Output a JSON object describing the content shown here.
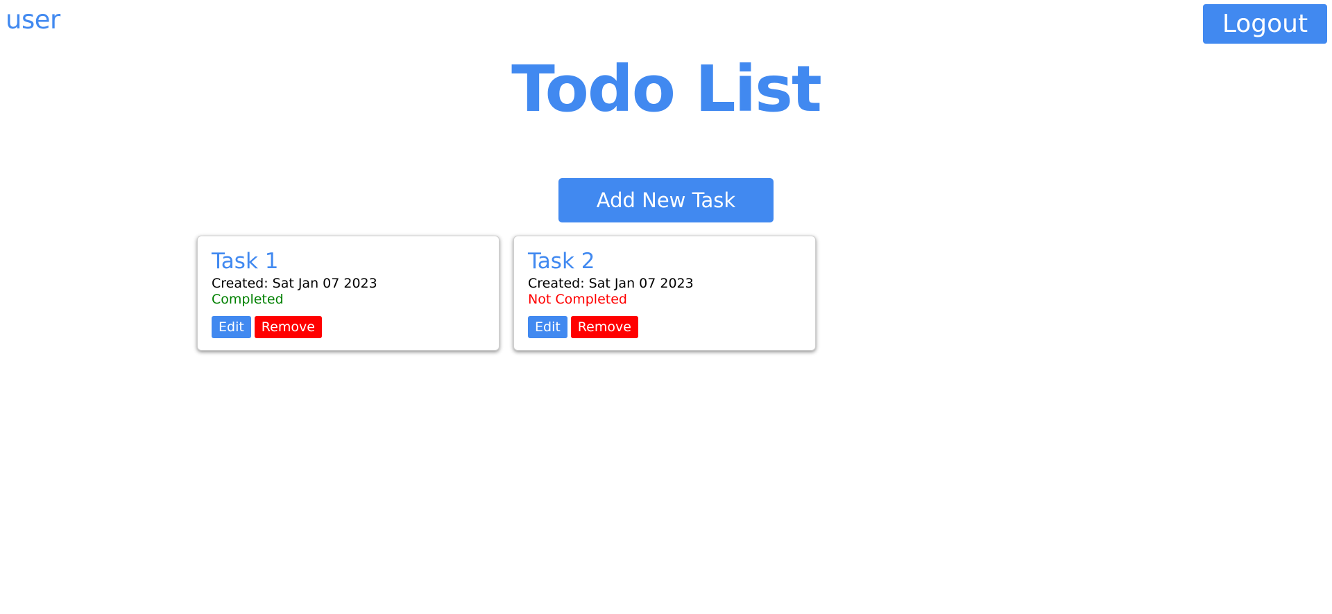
{
  "header": {
    "username": "user",
    "logout_label": "Logout"
  },
  "main": {
    "title": "Todo List",
    "add_task_label": "Add New Task"
  },
  "tasks": [
    {
      "title": "Task 1",
      "created": "Created: Sat Jan 07 2023",
      "status": "Completed",
      "completed": true,
      "edit_label": "Edit",
      "remove_label": "Remove"
    },
    {
      "title": "Task 2",
      "created": "Created: Sat Jan 07 2023",
      "status": "Not Completed",
      "completed": false,
      "edit_label": "Edit",
      "remove_label": "Remove"
    }
  ],
  "colors": {
    "accent": "#4189f0",
    "danger": "#ff0000",
    "success": "#008000"
  }
}
